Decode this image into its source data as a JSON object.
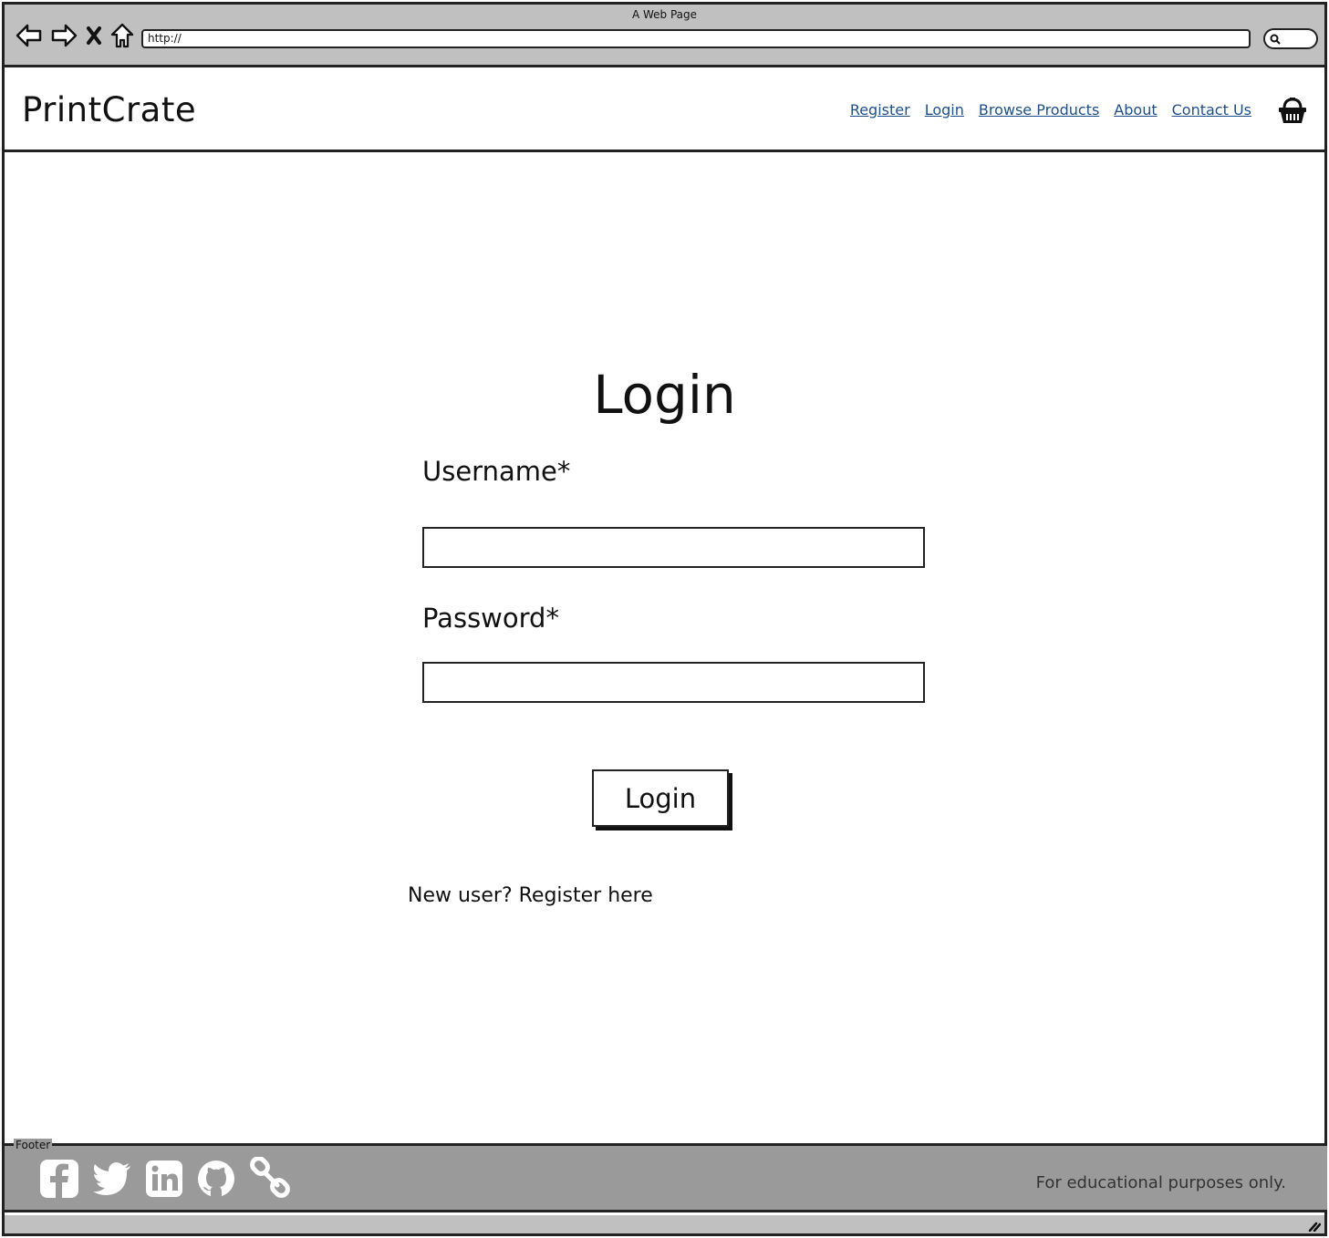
{
  "window": {
    "title": "A Web Page",
    "url": "http://"
  },
  "header": {
    "brand": "PrintCrate",
    "nav": [
      {
        "label": "Register"
      },
      {
        "label": "Login"
      },
      {
        "label": "Browse Products"
      },
      {
        "label": "About"
      },
      {
        "label": "Contact Us"
      }
    ],
    "cart_icon": "shopping-basket-icon",
    "link_color": "#1e4f8a"
  },
  "main": {
    "title": "Login",
    "username_label": "Username*",
    "username_value": "",
    "password_label": "Password*",
    "password_value": "",
    "login_button": "Login",
    "register_prompt": "New user? Register here"
  },
  "footer": {
    "label": "Footer",
    "social_icons": [
      "facebook-icon",
      "twitter-icon",
      "linkedin-icon",
      "github-icon",
      "link-icon"
    ],
    "note": "For educational purposes only."
  }
}
